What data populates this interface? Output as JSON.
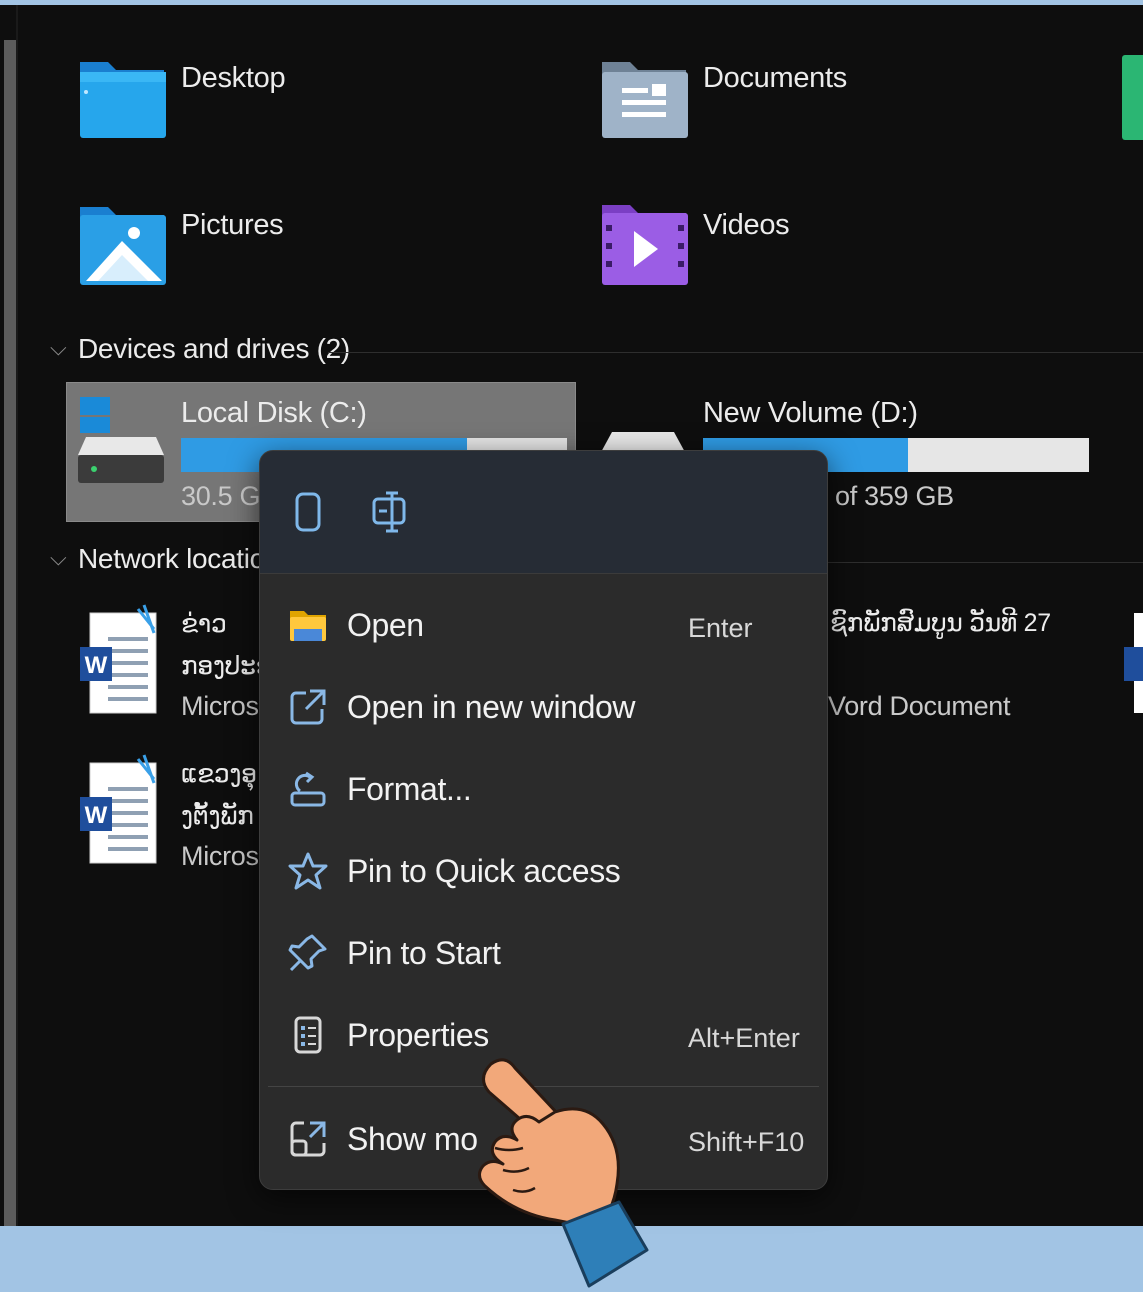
{
  "folders": [
    {
      "label": "Desktop"
    },
    {
      "label": "Documents"
    },
    {
      "label": "Pictures"
    },
    {
      "label": "Videos"
    }
  ],
  "devices": {
    "section_title": "Devices and drives (2)",
    "drives": [
      {
        "name": "Local Disk (C:)",
        "space_text": "30.5 GE",
        "used_fraction": 0.74
      },
      {
        "name": "New Volume (D:)",
        "space_text": "of 359 GB",
        "used_fraction": 0.53
      }
    ]
  },
  "network": {
    "section_title": "Network locatior",
    "files": [
      {
        "line1": "ຂ່າວ",
        "line2": "ກອງປະຊ",
        "type": "Microsc"
      },
      {
        "line1": "ແຂວງອຸ",
        "line2": "ງຕັ້ງພັກ",
        "type": "Microsc"
      }
    ],
    "right_file": {
      "line1": "ຊົກພັກສົມບູນ ວັນທີ 27",
      "type": "Vord Document"
    }
  },
  "context_menu": {
    "top_icons": [
      "copy-icon",
      "rename-icon"
    ],
    "items": [
      {
        "label": "Open",
        "shortcut": "Enter",
        "icon": "folder-icon"
      },
      {
        "label": "Open in new window",
        "shortcut": "",
        "icon": "open-new-window-icon"
      },
      {
        "label": "Format...",
        "shortcut": "",
        "icon": "format-icon"
      },
      {
        "label": "Pin to Quick access",
        "shortcut": "",
        "icon": "star-icon"
      },
      {
        "label": "Pin to Start",
        "shortcut": "",
        "icon": "pin-icon"
      },
      {
        "label": "Properties",
        "shortcut": "Alt+Enter",
        "icon": "properties-icon"
      },
      {
        "label": "Show mo",
        "shortcut": "Shift+F10",
        "icon": "show-more-icon"
      }
    ]
  },
  "colors": {
    "accent": "#2f9be4",
    "background": "#0e0e0e",
    "menu": "#2b2b2b",
    "frame": "#a2c4e4"
  }
}
